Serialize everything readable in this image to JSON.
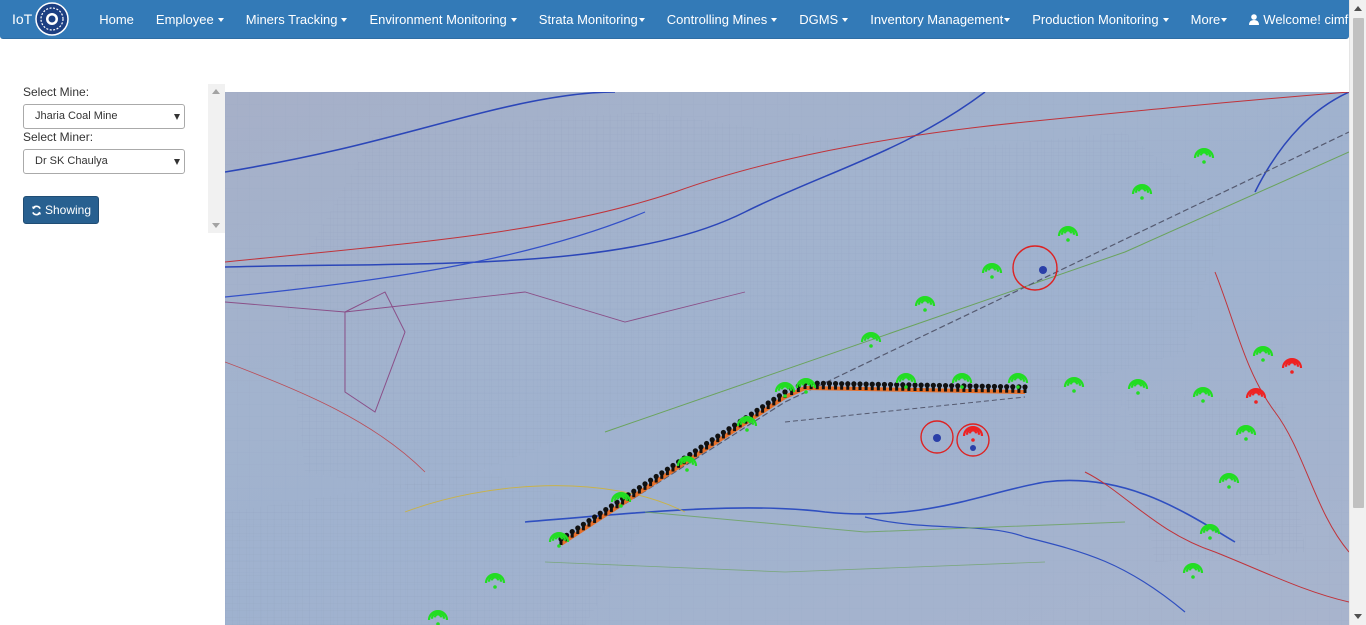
{
  "navbar": {
    "brand": "IoT",
    "items": [
      {
        "label": "Home",
        "caret": false
      },
      {
        "label": "Employee",
        "caret": true
      },
      {
        "label": "Miners Tracking",
        "caret": true
      },
      {
        "label": "Environment Monitoring",
        "caret": true
      },
      {
        "label": "Strata Monitoring",
        "caret": true
      },
      {
        "label": "Controlling Mines",
        "caret": true
      },
      {
        "label": "DGMS",
        "caret": true
      },
      {
        "label": "Inventory Management",
        "caret": true
      },
      {
        "label": "Production Monitoring",
        "caret": true
      },
      {
        "label": "More",
        "caret": true
      }
    ],
    "user": "Welcome! cimfr"
  },
  "sidebar": {
    "mine_label": "Select Mine:",
    "mine_value": "Jharia Coal Mine",
    "miner_label": "Select Miner:",
    "miner_value": "Dr SK Chaulya",
    "button_label": "Showing"
  },
  "colors": {
    "navbar": "#337ab7",
    "button": "#286090",
    "wifi_active": "#22dd22",
    "wifi_inactive": "#ee2222",
    "track": "#e8702a"
  },
  "map": {
    "image_description_icons": [
      "wifi-icon-green",
      "wifi-icon-red",
      "miner-marker"
    ]
  }
}
